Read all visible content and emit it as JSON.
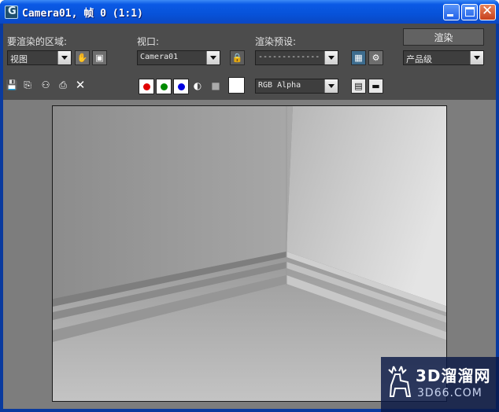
{
  "window": {
    "title": "Camera01, 帧 0 (1:1)",
    "controls": {
      "minimize": "minimize-icon",
      "maximize": "maximize-icon",
      "close": "close-icon"
    }
  },
  "toolbar": {
    "area_label": "要渲染的区域:",
    "area_value": "视图",
    "viewport_label": "视口:",
    "viewport_value": "Camera01",
    "preset_label": "渲染预设:",
    "preset_value": "-------------",
    "render_button": "渲染",
    "quality_value": "产品级",
    "channel_value": "RGB Alpha"
  },
  "icons": {
    "pan": "hand-icon",
    "region": "region-icon",
    "lock_viewport": "lock-icon",
    "render_setup": "render-setup-icon",
    "environment": "gear-icon",
    "save": "save-icon",
    "copy": "copy-icon",
    "clone": "clone-window-icon",
    "print": "print-icon",
    "clear": "clear-icon",
    "mono": "monochrome-icon",
    "clear_channel": "clear-channel-icon",
    "toggle_ui_overlay": "overlay-icon",
    "toggle_ui": "ui-icon"
  },
  "channels": {
    "red": "#e00000",
    "green": "#008a00",
    "blue": "#0000e0"
  },
  "colors": {
    "titlebar": "#0752d9",
    "panel": "#4c4c4c",
    "viewport": "#7d7d7d"
  },
  "watermark": {
    "brand": "3D溜溜网",
    "site": "3D66.COM"
  }
}
